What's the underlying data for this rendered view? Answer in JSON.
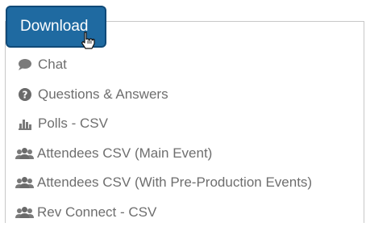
{
  "download": {
    "label": "Download"
  },
  "menu": {
    "items": [
      {
        "label": "Chat",
        "icon": "chat-bubble-icon"
      },
      {
        "label": "Questions & Answers",
        "icon": "question-circle-icon"
      },
      {
        "label": "Polls - CSV",
        "icon": "bar-chart-icon"
      },
      {
        "label": "Attendees CSV (Main Event)",
        "icon": "users-icon"
      },
      {
        "label": "Attendees CSV (With Pre-Production Events)",
        "icon": "users-icon"
      },
      {
        "label": "Rev Connect - CSV",
        "icon": "users-icon"
      }
    ]
  },
  "colors": {
    "button_bg": "#1f6aa1",
    "button_border": "#104a78",
    "menu_text": "#6e6e6e"
  }
}
